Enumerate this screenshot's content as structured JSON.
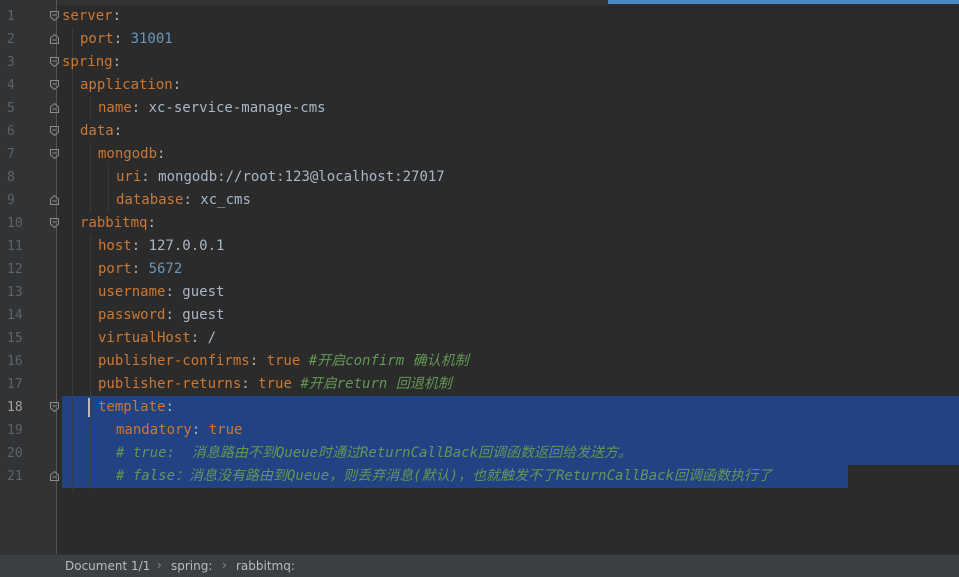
{
  "lines": [
    {
      "n": "1",
      "tokens": [
        [
          "key",
          "server"
        ],
        [
          "punc",
          ":"
        ]
      ]
    },
    {
      "n": "2",
      "tokens": [
        [
          "key",
          "port"
        ],
        [
          "punc",
          ": "
        ],
        [
          "num",
          "31001"
        ]
      ]
    },
    {
      "n": "3",
      "tokens": [
        [
          "key",
          "spring"
        ],
        [
          "punc",
          ":"
        ]
      ]
    },
    {
      "n": "4",
      "tokens": [
        [
          "key",
          "application"
        ],
        [
          "punc",
          ":"
        ]
      ]
    },
    {
      "n": "5",
      "tokens": [
        [
          "key",
          "name"
        ],
        [
          "punc",
          ": "
        ],
        [
          "str",
          "xc-service-manage-cms"
        ]
      ]
    },
    {
      "n": "6",
      "tokens": [
        [
          "key",
          "data"
        ],
        [
          "punc",
          ":"
        ]
      ]
    },
    {
      "n": "7",
      "tokens": [
        [
          "key",
          "mongodb"
        ],
        [
          "punc",
          ":"
        ]
      ]
    },
    {
      "n": "8",
      "tokens": [
        [
          "key",
          "uri"
        ],
        [
          "punc",
          ": "
        ],
        [
          "str",
          "mongodb://root:123@localhost:27017"
        ]
      ]
    },
    {
      "n": "9",
      "tokens": [
        [
          "key",
          "database"
        ],
        [
          "punc",
          ": "
        ],
        [
          "str",
          "xc_cms"
        ]
      ]
    },
    {
      "n": "10",
      "tokens": [
        [
          "key",
          "rabbitmq"
        ],
        [
          "punc",
          ":"
        ]
      ]
    },
    {
      "n": "11",
      "tokens": [
        [
          "key",
          "host"
        ],
        [
          "punc",
          ": "
        ],
        [
          "str",
          "127.0.0.1"
        ]
      ]
    },
    {
      "n": "12",
      "tokens": [
        [
          "key",
          "port"
        ],
        [
          "punc",
          ": "
        ],
        [
          "num",
          "5672"
        ]
      ]
    },
    {
      "n": "13",
      "tokens": [
        [
          "key",
          "username"
        ],
        [
          "punc",
          ": "
        ],
        [
          "str",
          "guest"
        ]
      ]
    },
    {
      "n": "14",
      "tokens": [
        [
          "key",
          "password"
        ],
        [
          "punc",
          ": "
        ],
        [
          "str",
          "guest"
        ]
      ]
    },
    {
      "n": "15",
      "tokens": [
        [
          "key",
          "virtualHost"
        ],
        [
          "punc",
          ": "
        ],
        [
          "str",
          "/"
        ]
      ]
    },
    {
      "n": "16",
      "tokens": [
        [
          "key",
          "publisher-confirms"
        ],
        [
          "punc",
          ": "
        ],
        [
          "bool",
          "true"
        ],
        [
          "punc",
          " "
        ],
        [
          "comment",
          "#开启confirm 确认机制"
        ]
      ]
    },
    {
      "n": "17",
      "tokens": [
        [
          "key",
          "publisher-returns"
        ],
        [
          "punc",
          ": "
        ],
        [
          "bool",
          "true"
        ],
        [
          "punc",
          " "
        ],
        [
          "comment",
          "#开启return 回退机制"
        ]
      ]
    },
    {
      "n": "18",
      "tokens": [
        [
          "key",
          "template"
        ],
        [
          "punc",
          ":"
        ]
      ]
    },
    {
      "n": "19",
      "tokens": [
        [
          "key",
          "mandatory"
        ],
        [
          "punc",
          ": "
        ],
        [
          "bool",
          "true"
        ]
      ]
    },
    {
      "n": "20",
      "tokens": [
        [
          "comment",
          "# true:  消息路由不到Queue时通过ReturnCallBack回调函数返回给发送方。"
        ]
      ]
    },
    {
      "n": "21",
      "tokens": [
        [
          "comment",
          "# false：消息没有路由到Queue，则丢弃消息(默认)，也就触发不了ReturnCallBack回调函数执行了"
        ]
      ]
    }
  ],
  "breadcrumb": {
    "items": [
      "Document 1/1",
      "spring:",
      "rabbitmq:"
    ]
  },
  "colors": {
    "background": "#2b2b2b",
    "gutter": "#313335",
    "key": "#cc7832",
    "number": "#6897bb",
    "comment": "#629755",
    "selection": "#214283"
  }
}
